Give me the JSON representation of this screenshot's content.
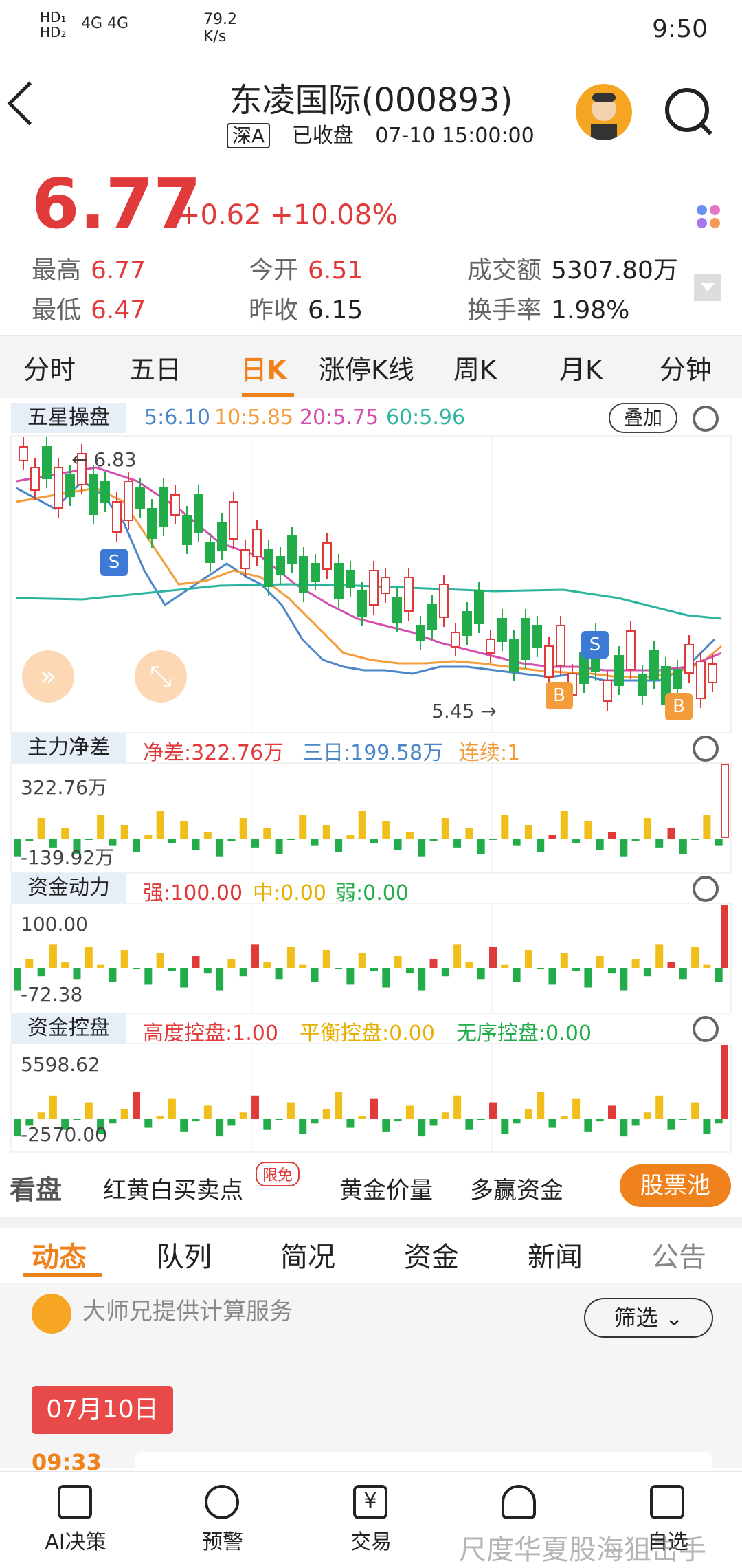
{
  "status_bar": {
    "hd1": "HD₁",
    "hd2": "HD₂",
    "net": "4G  4G",
    "speed": "79.2 K/s",
    "time": "9:50"
  },
  "header": {
    "title": "东凌国际(000893)",
    "market_tag": "深A",
    "status": "已收盘",
    "datetime": "07-10 15:00:00"
  },
  "quote": {
    "price": "6.77",
    "change": "+0.62",
    "change_pct": "+10.08%",
    "high_label": "最高",
    "high": "6.77",
    "low_label": "最低",
    "low": "6.47",
    "open_label": "今开",
    "open": "6.51",
    "prev_label": "昨收",
    "prev": "6.15",
    "amount_label": "成交额",
    "amount": "5307.80万",
    "turnover_label": "换手率",
    "turnover": "1.98%"
  },
  "period_tabs": [
    "分时",
    "五日",
    "日K",
    "涨停K线",
    "周K",
    "月K",
    "分钟"
  ],
  "kline": {
    "label": "五星操盘",
    "ma5": "5:6.10",
    "ma10": "10:5.85",
    "ma20": "20:5.75",
    "ma60": "60:5.96",
    "overlay": "叠加",
    "high_marker": "← 6.83",
    "low_marker": "5.45 →",
    "buy": "B",
    "sell": "S"
  },
  "panel1": {
    "label": "主力净差",
    "a": "净差:322.76万",
    "b": "三日:199.58万",
    "c": "连续:1",
    "top": "322.76万",
    "bottom": "-139.92万"
  },
  "panel2": {
    "label": "资金动力",
    "a": "强:100.00",
    "b": "中:0.00",
    "c": "弱:0.00",
    "top": "100.00",
    "bottom": "-72.38"
  },
  "panel3": {
    "label": "资金控盘",
    "a": "高度控盘:1.00",
    "b": "平衡控盘:0.00",
    "c": "无序控盘:0.00",
    "top": "5598.62",
    "bottom": "-2570.00"
  },
  "strip": {
    "look": "看盘",
    "item1": "红黄白买卖点",
    "badge": "限免",
    "item2": "黄金价量",
    "item3": "多赢资金",
    "pool": "股票池"
  },
  "news_tabs": [
    "动态",
    "队列",
    "简况",
    "资金",
    "新闻",
    "公告"
  ],
  "feed": {
    "provider": "大师兄提供计算服务",
    "filter": "筛选",
    "date": "07月10日",
    "time": "09:33"
  },
  "bottom_nav": [
    "AI决策",
    "预警",
    "交易",
    "",
    "自选"
  ],
  "watermark": "尺度华夏股海狙击手",
  "colors": {
    "up": "#e03a3a",
    "down": "#22ad4a",
    "accent": "#f0821e",
    "ma5": "#4a86c8",
    "ma10": "#f39c3c",
    "ma20": "#d34fb0",
    "ma60": "#2bb5a0"
  }
}
